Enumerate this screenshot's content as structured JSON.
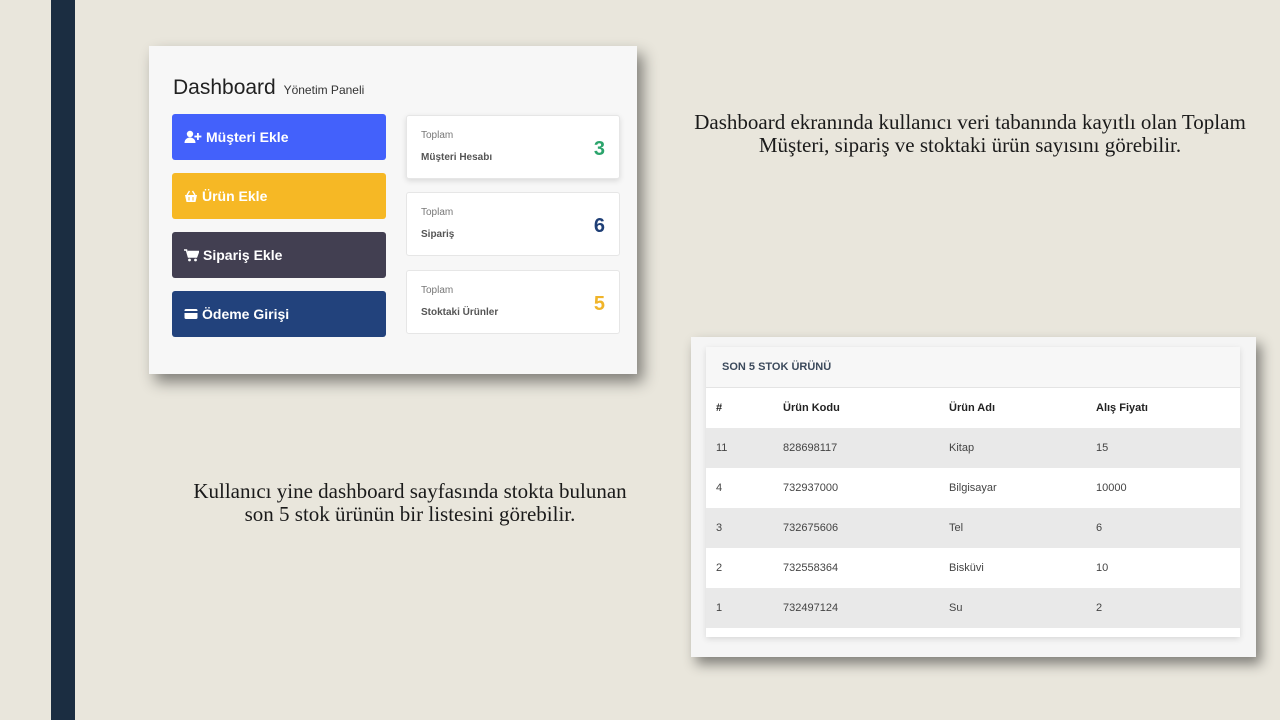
{
  "dashboard": {
    "title": "Dashboard",
    "subtitle": "Yönetim Paneli",
    "buttons": [
      {
        "label": "Müşteri Ekle",
        "icon": "user-plus-icon"
      },
      {
        "label": "Ürün Ekle",
        "icon": "basket-icon"
      },
      {
        "label": "Sipariş Ekle",
        "icon": "cart-icon"
      },
      {
        "label": "Ödeme Girişi",
        "icon": "credit-card-icon"
      }
    ],
    "stats": [
      {
        "top": "Toplam",
        "label": "Müşteri Hesabı",
        "value": "3",
        "color": "#2ba46c"
      },
      {
        "top": "Toplam",
        "label": "Sipariş",
        "value": "6",
        "color": "#1f3f76"
      },
      {
        "top": "Toplam",
        "label": "Stoktaki Ürünler",
        "value": "5",
        "color": "#f0b429"
      }
    ]
  },
  "captions": {
    "dashboard_text": "Dashboard ekranında kullanıcı veri tabanında kayıtlı olan Toplam Müşteri, sipariş ve stoktaki ürün sayısını görebilir.",
    "stock_text": "Kullanıcı yine dashboard sayfasında stokta bulunan son 5 stok ürünün bir listesini görebilir."
  },
  "stock": {
    "title": "SON 5 STOK ÜRÜNÜ",
    "columns": [
      "#",
      "Ürün Kodu",
      "Ürün Adı",
      "Alış Fiyatı"
    ],
    "rows": [
      [
        "11",
        "828698117",
        "Kitap",
        "15"
      ],
      [
        "4",
        "732937000",
        "Bilgisayar",
        "10000"
      ],
      [
        "3",
        "732675606",
        "Tel",
        "6"
      ],
      [
        "2",
        "732558364",
        "Bisküvi",
        "10"
      ],
      [
        "1",
        "732497124",
        "Su",
        "2"
      ]
    ]
  }
}
